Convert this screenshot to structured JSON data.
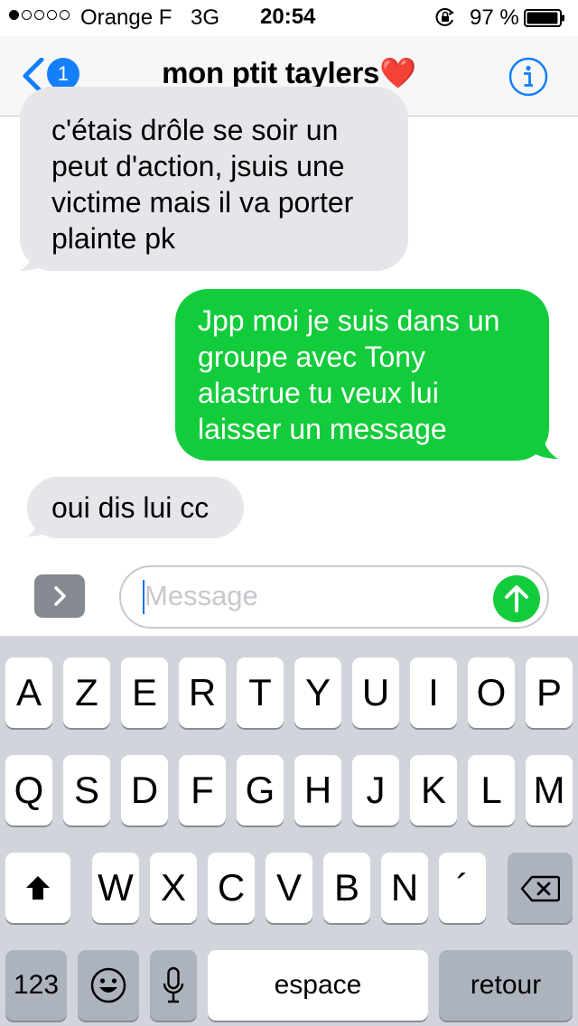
{
  "status_bar": {
    "signal_bars_filled": 1,
    "signal_bars_total": 5,
    "carrier": "Orange F",
    "network": "3G",
    "time": "20:54",
    "lock_icon": "orientation-lock-icon",
    "battery_percent": "97 %",
    "battery_level": 0.97
  },
  "nav": {
    "back_icon": "chevron-left-icon",
    "back_badge": "1",
    "title": "mon ptit taylers❤️",
    "info_icon": "info-icon",
    "accent_color": "#157efb"
  },
  "messages": [
    {
      "direction": "incoming",
      "lines": [
        "c'étais drôle se soir un",
        "peut d'action, jsuis une",
        "victime mais il va porter",
        "plainte pk"
      ]
    },
    {
      "direction": "outgoing",
      "lines": [
        "Jpp moi je suis dans un",
        "groupe avec Tony",
        "alastrue tu veux lui",
        "laisser un message"
      ]
    },
    {
      "direction": "incoming",
      "lines": [
        "oui dis lui cc"
      ]
    }
  ],
  "colors": {
    "incoming_bubble": "#e5e5ea",
    "outgoing_bubble": "#13cc3b",
    "keyboard_bg": "#d1d5db"
  },
  "input": {
    "apps_icon": "chevron-right-icon",
    "placeholder": "Message",
    "send_icon": "arrow-up-icon"
  },
  "keyboard": {
    "row1": [
      "A",
      "Z",
      "E",
      "R",
      "T",
      "Y",
      "U",
      "I",
      "O",
      "P"
    ],
    "row2": [
      "Q",
      "S",
      "D",
      "F",
      "G",
      "H",
      "J",
      "K",
      "L",
      "M"
    ],
    "row3": [
      "W",
      "X",
      "C",
      "V",
      "B",
      "N",
      "´"
    ],
    "shift_icon": "shift-icon",
    "delete_icon": "delete-icon",
    "numbers_label": "123",
    "emoji_icon": "emoji-icon",
    "mic_icon": "microphone-icon",
    "space_label": "espace",
    "return_label": "retour"
  }
}
